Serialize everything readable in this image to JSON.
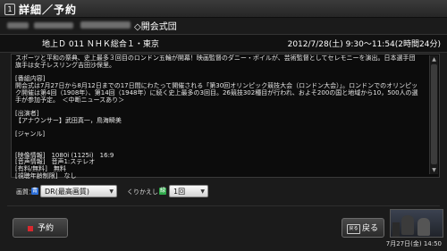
{
  "header": {
    "badge": "1",
    "title": "詳細／予約"
  },
  "program": {
    "title": "◇開会式団"
  },
  "info": {
    "channel": "地上Ｄ 011 ＮＨＫ総合１・東京",
    "datetime": "2012/7/28(土) 9:30～11:54(2時間24分)"
  },
  "description": {
    "text": "スポーツと平和の祭典、史上最多３回目のロンドン五輪が開幕！映画監督のダニー・ボイルが、芸術監督としてセレモニーを演出。日本選手団旗手は女子レスリング吉田沙保里。\n\n[番組内容]\n開会式は7月27日から8月12日までの17日間にわたって開催される「第30回オリンピック競技大会（ロンドン大会）」。ロンドンでのオリンピック開催は第4回（1908年）、第14回（1948年）に続く史上最多の3回目。26競技302種目が行われ、およそ200の国と地域から10，500人の選手が参加予定。　＜中断ニュースあり＞\n\n[出演者]\n【アナウンサー】武田真一，鳥海瞬美\n\n[ジャンル]\n\n\n[映像情報]　1080i (1125i)　16:9\n[音声情報]　音声1:ステレオ\n[有料/無料]　無料\n[視聴年齢制限]　なし"
  },
  "settings": {
    "quality_label": "画質：",
    "quality_badge": "青",
    "quality_value": "DR(最高画質)",
    "repeat_label": "くりかえし：",
    "repeat_badge": "緑",
    "repeat_value": "1回"
  },
  "buttons": {
    "reserve": "予約",
    "back_badge": "戻る",
    "back": "戻る"
  },
  "status": {
    "clock": "7月27日(金) 14:50"
  },
  "colors": {
    "accent_blue": "#2d6fd8",
    "accent_green": "#2fa84a",
    "reserve_red": "#d8282e"
  }
}
